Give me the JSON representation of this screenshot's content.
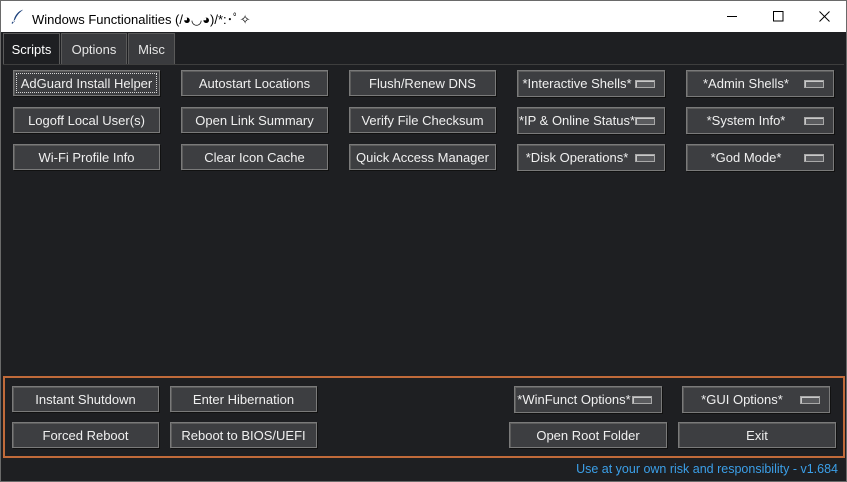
{
  "window": {
    "title": "Windows Functionalities (/◕◡◕)/*:･ﾟ✧",
    "icons": {
      "app": "feather-icon",
      "minimize": "minimize-icon",
      "maximize": "maximize-icon",
      "close": "close-icon"
    }
  },
  "tabs": [
    {
      "label": "Scripts",
      "active": true
    },
    {
      "label": "Options",
      "active": false
    },
    {
      "label": "Misc",
      "active": false
    }
  ],
  "scripts": {
    "buttons": [
      "AdGuard Install Helper",
      "Autostart Locations",
      "Flush/Renew DNS",
      "Logoff Local User(s)",
      "Open Link Summary",
      "Verify File Checksum",
      "Wi-Fi Profile Info",
      "Clear Icon Cache",
      "Quick Access Manager"
    ],
    "menus": [
      "*Interactive Shells*",
      "*Admin Shells*",
      "*IP & Online Status*",
      "*System Info*",
      "*Disk Operations*",
      "*God Mode*"
    ]
  },
  "bottom": {
    "buttons": [
      "Instant Shutdown",
      "Enter Hibernation",
      "Forced Reboot",
      "Reboot to BIOS/UEFI",
      "Open Root Folder",
      "Exit"
    ],
    "menus": [
      "*WinFunct Options*",
      "*GUI Options*"
    ]
  },
  "status": {
    "text": "Use at your own risk and responsibility - v1.684"
  },
  "colors": {
    "background": "#1e1f22",
    "button": "#3d3e41",
    "frame_accent": "#c06a3a",
    "status_link": "#3b9fe8"
  }
}
